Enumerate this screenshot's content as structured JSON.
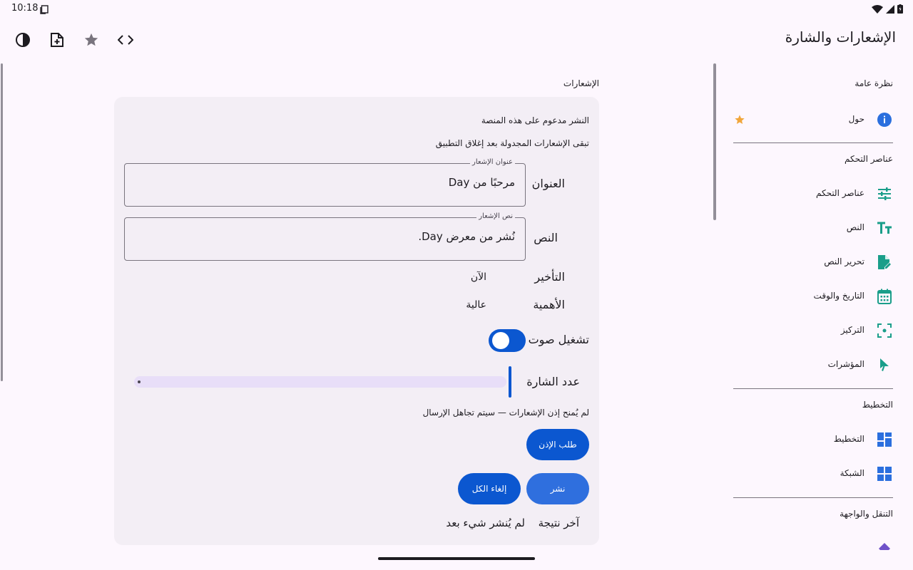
{
  "status_bar": {
    "time": "10:18"
  },
  "app_bar": {
    "title": "الإشعارات والشارة",
    "icons": [
      "theme-toggle-icon",
      "add-document-icon",
      "star-icon",
      "code-icon"
    ]
  },
  "section": {
    "label": "الإشعارات"
  },
  "card": {
    "info_supported": "النشر مدعوم على هذه المنصة",
    "info_persist": "تبقى الإشعارات المجدولة بعد إغلاق التطبيق",
    "title_row": {
      "label": "العنوان",
      "field_label": "عنوان الإشعار",
      "value": "مرحبًا من Day"
    },
    "body_row": {
      "label": "النص",
      "field_label": "نص الإشعار",
      "value": "نُشر من معرض Day."
    },
    "delay_row": {
      "label": "التأخير",
      "value": "الآن"
    },
    "importance_row": {
      "label": "الأهمية",
      "value": "عالية"
    },
    "sound_row": {
      "label": "تشغيل صوت",
      "on": true
    },
    "badge_row": {
      "label": "عدد الشارة",
      "value": 0
    },
    "permission_note": "لم يُمنح إذن الإشعارات — سيتم تجاهل الإرسال",
    "request_permission_button": "طلب الإذن",
    "publish_button": "نشر",
    "cancel_all_button": "إلغاء الكل",
    "last_result": {
      "label": "آخر نتيجة",
      "value": "لم يُنشر شيء بعد"
    }
  },
  "nav": {
    "overview_header": "نظرة عامة",
    "about": "حول",
    "controls_header": "عناصر التحكم",
    "controls": "عناصر التحكم",
    "text": "النص",
    "text_edit": "تحرير النص",
    "date_time": "التاريخ والوقت",
    "focus": "التركيز",
    "pointers": "المؤشرات",
    "layout_header": "التخطيط",
    "layout": "التخطيط",
    "grid": "الشبكة",
    "navigation_header": "التنقل والواجهة"
  },
  "colors": {
    "primary": "#0b57d0",
    "primary_light": "#2f6fde",
    "nav_accent": "#1a9e8a",
    "info_blue": "#2b6fde",
    "star_orange": "#f1a63b"
  }
}
